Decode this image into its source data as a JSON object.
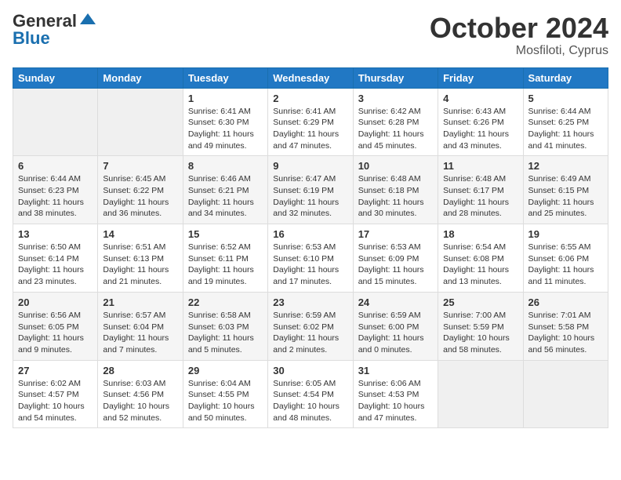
{
  "header": {
    "logo_general": "General",
    "logo_blue": "Blue",
    "month_title": "October 2024",
    "subtitle": "Mosfiloti, Cyprus"
  },
  "weekdays": [
    "Sunday",
    "Monday",
    "Tuesday",
    "Wednesday",
    "Thursday",
    "Friday",
    "Saturday"
  ],
  "weeks": [
    [
      {
        "day": "",
        "info": ""
      },
      {
        "day": "",
        "info": ""
      },
      {
        "day": "1",
        "info": "Sunrise: 6:41 AM\nSunset: 6:30 PM\nDaylight: 11 hours and 49 minutes."
      },
      {
        "day": "2",
        "info": "Sunrise: 6:41 AM\nSunset: 6:29 PM\nDaylight: 11 hours and 47 minutes."
      },
      {
        "day": "3",
        "info": "Sunrise: 6:42 AM\nSunset: 6:28 PM\nDaylight: 11 hours and 45 minutes."
      },
      {
        "day": "4",
        "info": "Sunrise: 6:43 AM\nSunset: 6:26 PM\nDaylight: 11 hours and 43 minutes."
      },
      {
        "day": "5",
        "info": "Sunrise: 6:44 AM\nSunset: 6:25 PM\nDaylight: 11 hours and 41 minutes."
      }
    ],
    [
      {
        "day": "6",
        "info": "Sunrise: 6:44 AM\nSunset: 6:23 PM\nDaylight: 11 hours and 38 minutes."
      },
      {
        "day": "7",
        "info": "Sunrise: 6:45 AM\nSunset: 6:22 PM\nDaylight: 11 hours and 36 minutes."
      },
      {
        "day": "8",
        "info": "Sunrise: 6:46 AM\nSunset: 6:21 PM\nDaylight: 11 hours and 34 minutes."
      },
      {
        "day": "9",
        "info": "Sunrise: 6:47 AM\nSunset: 6:19 PM\nDaylight: 11 hours and 32 minutes."
      },
      {
        "day": "10",
        "info": "Sunrise: 6:48 AM\nSunset: 6:18 PM\nDaylight: 11 hours and 30 minutes."
      },
      {
        "day": "11",
        "info": "Sunrise: 6:48 AM\nSunset: 6:17 PM\nDaylight: 11 hours and 28 minutes."
      },
      {
        "day": "12",
        "info": "Sunrise: 6:49 AM\nSunset: 6:15 PM\nDaylight: 11 hours and 25 minutes."
      }
    ],
    [
      {
        "day": "13",
        "info": "Sunrise: 6:50 AM\nSunset: 6:14 PM\nDaylight: 11 hours and 23 minutes."
      },
      {
        "day": "14",
        "info": "Sunrise: 6:51 AM\nSunset: 6:13 PM\nDaylight: 11 hours and 21 minutes."
      },
      {
        "day": "15",
        "info": "Sunrise: 6:52 AM\nSunset: 6:11 PM\nDaylight: 11 hours and 19 minutes."
      },
      {
        "day": "16",
        "info": "Sunrise: 6:53 AM\nSunset: 6:10 PM\nDaylight: 11 hours and 17 minutes."
      },
      {
        "day": "17",
        "info": "Sunrise: 6:53 AM\nSunset: 6:09 PM\nDaylight: 11 hours and 15 minutes."
      },
      {
        "day": "18",
        "info": "Sunrise: 6:54 AM\nSunset: 6:08 PM\nDaylight: 11 hours and 13 minutes."
      },
      {
        "day": "19",
        "info": "Sunrise: 6:55 AM\nSunset: 6:06 PM\nDaylight: 11 hours and 11 minutes."
      }
    ],
    [
      {
        "day": "20",
        "info": "Sunrise: 6:56 AM\nSunset: 6:05 PM\nDaylight: 11 hours and 9 minutes."
      },
      {
        "day": "21",
        "info": "Sunrise: 6:57 AM\nSunset: 6:04 PM\nDaylight: 11 hours and 7 minutes."
      },
      {
        "day": "22",
        "info": "Sunrise: 6:58 AM\nSunset: 6:03 PM\nDaylight: 11 hours and 5 minutes."
      },
      {
        "day": "23",
        "info": "Sunrise: 6:59 AM\nSunset: 6:02 PM\nDaylight: 11 hours and 2 minutes."
      },
      {
        "day": "24",
        "info": "Sunrise: 6:59 AM\nSunset: 6:00 PM\nDaylight: 11 hours and 0 minutes."
      },
      {
        "day": "25",
        "info": "Sunrise: 7:00 AM\nSunset: 5:59 PM\nDaylight: 10 hours and 58 minutes."
      },
      {
        "day": "26",
        "info": "Sunrise: 7:01 AM\nSunset: 5:58 PM\nDaylight: 10 hours and 56 minutes."
      }
    ],
    [
      {
        "day": "27",
        "info": "Sunrise: 6:02 AM\nSunset: 4:57 PM\nDaylight: 10 hours and 54 minutes."
      },
      {
        "day": "28",
        "info": "Sunrise: 6:03 AM\nSunset: 4:56 PM\nDaylight: 10 hours and 52 minutes."
      },
      {
        "day": "29",
        "info": "Sunrise: 6:04 AM\nSunset: 4:55 PM\nDaylight: 10 hours and 50 minutes."
      },
      {
        "day": "30",
        "info": "Sunrise: 6:05 AM\nSunset: 4:54 PM\nDaylight: 10 hours and 48 minutes."
      },
      {
        "day": "31",
        "info": "Sunrise: 6:06 AM\nSunset: 4:53 PM\nDaylight: 10 hours and 47 minutes."
      },
      {
        "day": "",
        "info": ""
      },
      {
        "day": "",
        "info": ""
      }
    ]
  ]
}
